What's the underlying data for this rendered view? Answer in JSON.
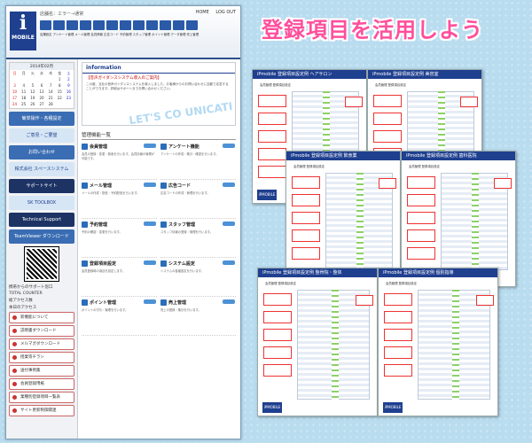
{
  "headline": "登録項目を活用しよう",
  "screenshot": {
    "logo": {
      "mark": "i",
      "text": "MOBILE"
    },
    "store_label": "店舗名：エラー→通常",
    "nav": {
      "home": "HOME",
      "logout": "LOG OUT"
    },
    "toolbar_labels": "店舗設定 アンケート管理 メール管理 会員情報 広告コード 予約管理 スタッフ管理 ポイント管理 データ管理 売上管理",
    "calendar": {
      "title": "2014年02月",
      "days": [
        "日",
        "月",
        "火",
        "水",
        "木",
        "金",
        "土",
        "",
        "",
        "",
        "",
        "",
        "1",
        "2",
        "3",
        "4",
        "5",
        "6",
        "7",
        "8",
        "9",
        "10",
        "11",
        "12",
        "13",
        "14",
        "15",
        "16",
        "17",
        "18",
        "19",
        "20",
        "21",
        "22",
        "23",
        "24",
        "25",
        "26",
        "27",
        "28",
        "",
        ""
      ]
    },
    "sidebar_banners": [
      "簡単操作・各種設定",
      "ご意見・ご要望",
      "お問い合わせ",
      "株式会社 スペースシステム",
      "サポートサイト",
      "SK TOOLBOX",
      "Technical Support",
      "TeamViewer ダウンロード"
    ],
    "qr_caption": "携帯からのサポート窓口",
    "counter": {
      "title": "TOTAL COUNTER",
      "members": "総アクセス数",
      "today": "本日のアクセス"
    },
    "side_buttons": [
      "新機能について",
      "説明書ダウンロード",
      "メルマガダウンロード",
      "授業等チラシ",
      "送付事例集",
      "会員登録用紙",
      "業種別登録項目一覧表",
      "サイト更新制御関連"
    ],
    "info": {
      "heading": "information",
      "headline": "【音声ガイダンスシステム導入のご案内】",
      "para": "この度、当社の音声ガイダンスシステムを導入しました。お客様からのお問い合わせに自動で応答することができます。詳細はサポートまでお問い合わせください。",
      "watermark": "LET'S CO UNICATI"
    },
    "kanri_title": "管理機能一覧",
    "modules": [
      {
        "name": "会員管理",
        "desc": "会員の登録・変更・検索を行います。会員情報の管理が可能です。"
      },
      {
        "name": "アンケート機能",
        "desc": "アンケートの作成・集計・確認を行います。"
      },
      {
        "name": "メール管理",
        "desc": "メールの作成・配信・予約配信を行います。"
      },
      {
        "name": "広告コード",
        "desc": "広告コードの作成・管理を行います。"
      },
      {
        "name": "予約管理",
        "desc": "予約の確認・変更を行います。"
      },
      {
        "name": "スタッフ管理",
        "desc": "スタッフ情報の登録・管理を行います。"
      },
      {
        "name": "登録項目設定",
        "desc": "会員登録時の項目を設定します。"
      },
      {
        "name": "システム設定",
        "desc": "システムの各種設定を行います。"
      },
      {
        "name": "ポイント管理",
        "desc": "ポイントの付与・管理を行います。"
      },
      {
        "name": "売上管理",
        "desc": "売上の登録・集計を行います。"
      }
    ]
  },
  "documents": [
    {
      "title": "iPmobile 登録項目設定例 ヘアサロン",
      "sub": "会員管理 登録項目設定"
    },
    {
      "title": "iPmobile 登録項目設定例 美容室",
      "sub": "会員管理 登録項目設定"
    },
    {
      "title": "iPmobile 登録項目設定例 飲食業",
      "sub": "会員管理 登録項目設定"
    },
    {
      "title": "iPmobile 登録項目設定例 歯科医院",
      "sub": "会員管理 登録項目設定"
    },
    {
      "title": "iPmobile 登録項目設定例 整骨院・整体",
      "sub": "会員管理 登録項目設定"
    },
    {
      "title": "iPmobile 登録項目設定例 個別指導",
      "sub": "会員管理 登録項目設定"
    }
  ],
  "doc_footer_logo": "iPMOBILE"
}
